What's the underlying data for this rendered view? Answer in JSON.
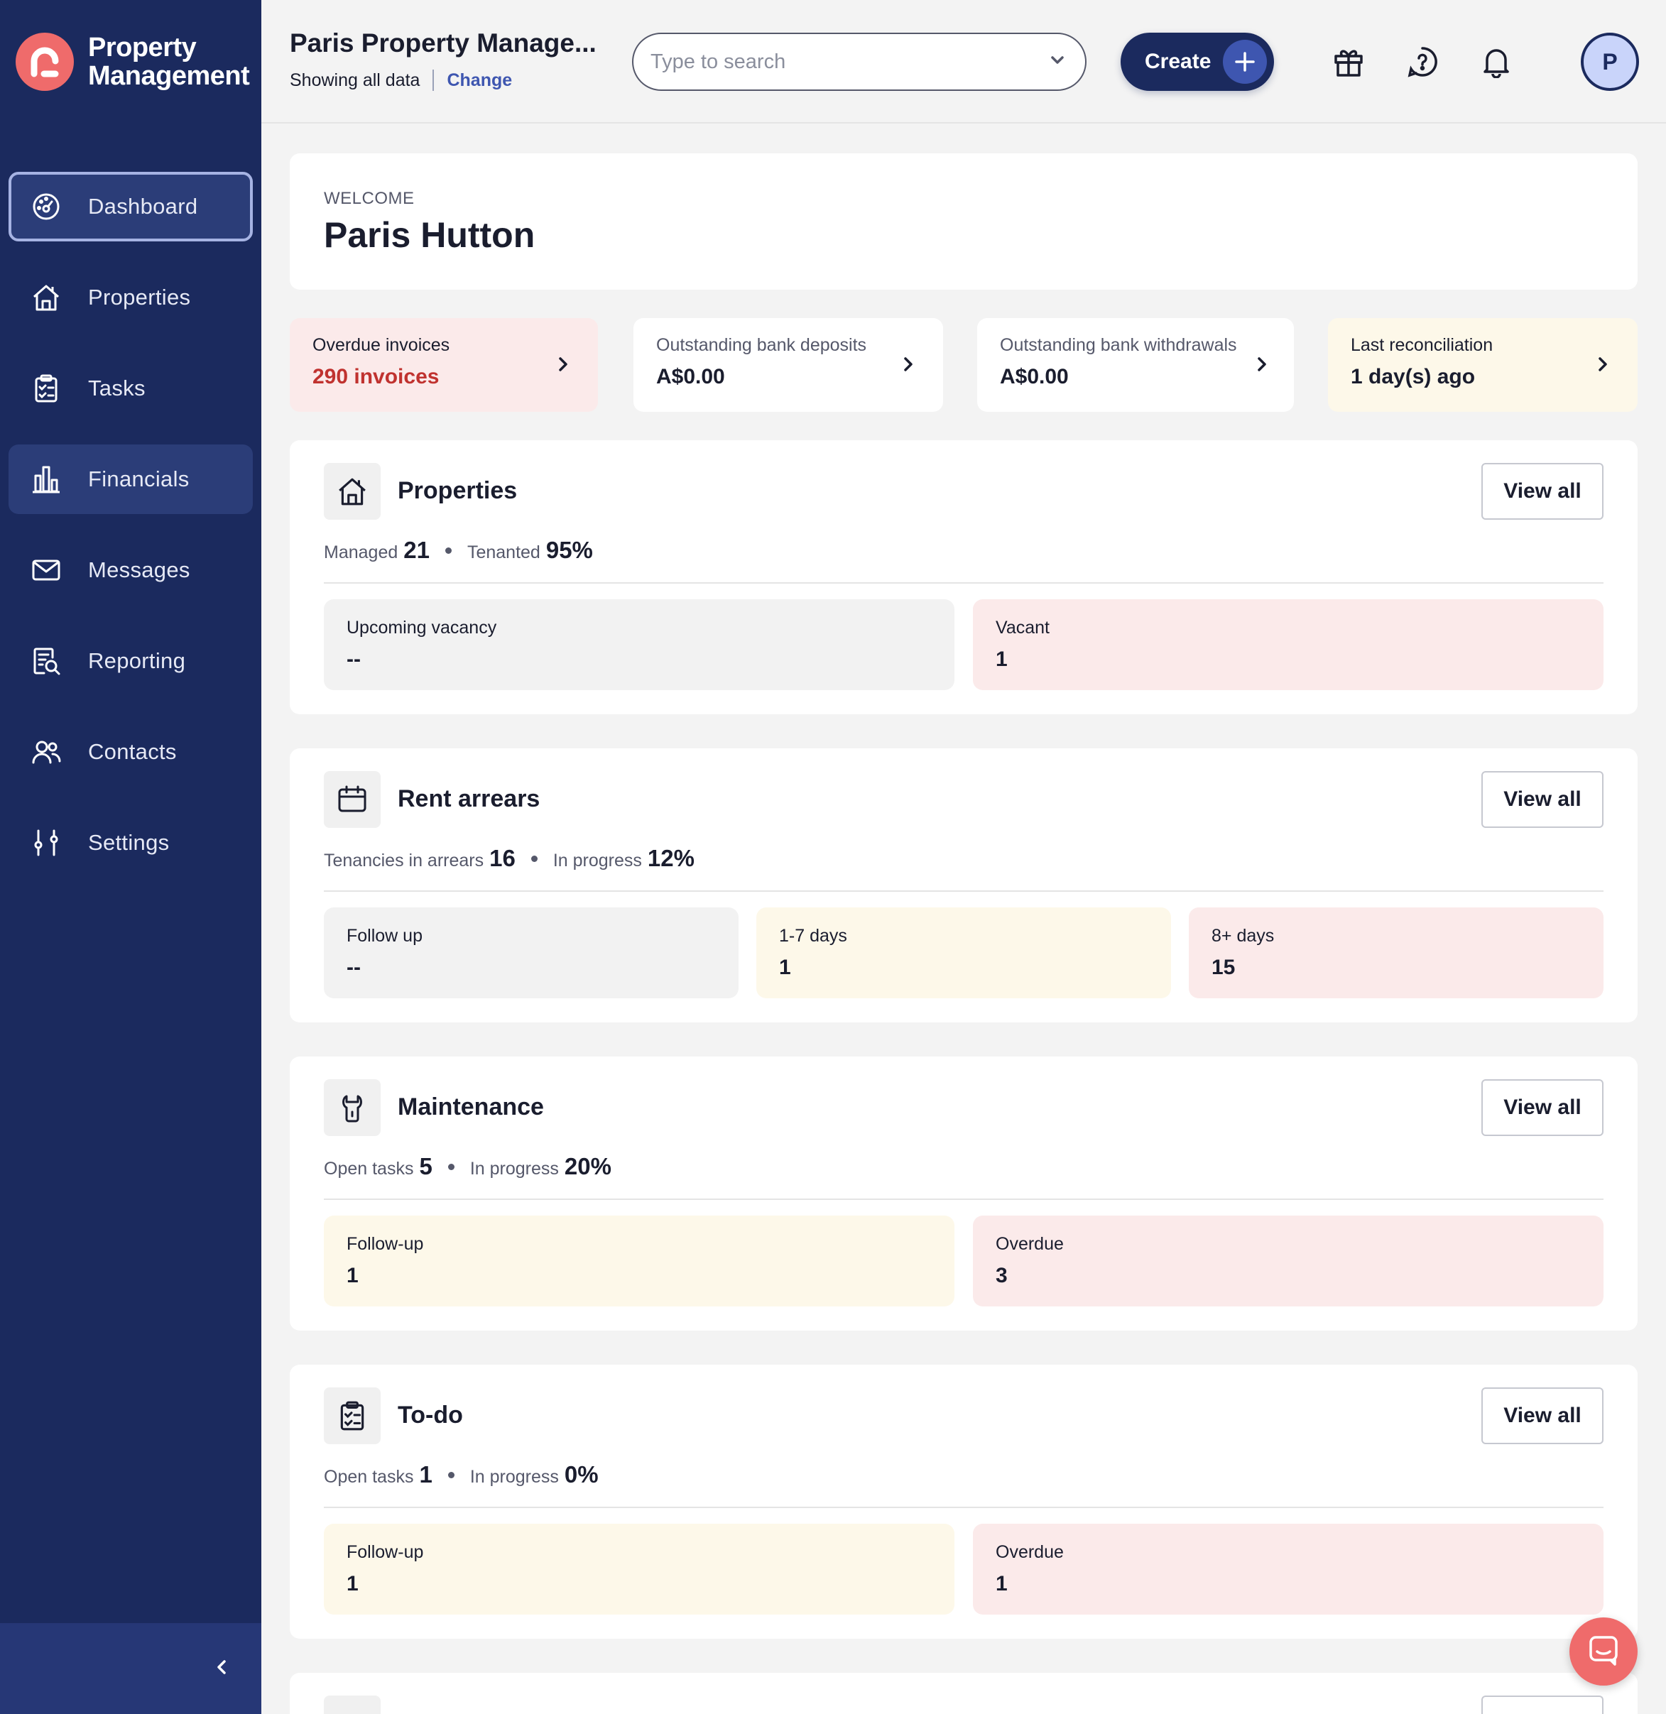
{
  "brand": {
    "line1": "Property",
    "line2": "Management",
    "logo_icon": "brand-logo-icon",
    "logo_color": "#ef6b6b"
  },
  "sidebar": {
    "items": [
      {
        "label": "Dashboard",
        "icon": "dashboard-icon"
      },
      {
        "label": "Properties",
        "icon": "house-icon"
      },
      {
        "label": "Tasks",
        "icon": "clipboard-icon"
      },
      {
        "label": "Financials",
        "icon": "bar-chart-icon"
      },
      {
        "label": "Messages",
        "icon": "envelope-icon"
      },
      {
        "label": "Reporting",
        "icon": "report-search-icon"
      },
      {
        "label": "Contacts",
        "icon": "users-icon"
      },
      {
        "label": "Settings",
        "icon": "sliders-icon"
      }
    ],
    "active": "Dashboard",
    "collapse_icon": "chevron-left-icon"
  },
  "header": {
    "org_title": "Paris Property Manage...",
    "org_sub": "Showing all data",
    "change_link": "Change",
    "search_placeholder": "Type to search",
    "create_label": "Create",
    "avatar_initial": "P"
  },
  "welcome": {
    "eyebrow": "WELCOME",
    "name": "Paris Hutton"
  },
  "stats": [
    {
      "label": "Overdue invoices",
      "value": "290 invoices"
    },
    {
      "label": "Outstanding bank deposits",
      "value": "A$0.00"
    },
    {
      "label": "Outstanding bank withdrawals",
      "value": "A$0.00"
    },
    {
      "label": "Last reconciliation",
      "value": "1 day(s) ago"
    }
  ],
  "sections": {
    "properties": {
      "title": "Properties",
      "view_all": "View all",
      "m1_label": "Managed",
      "m1_value": "21",
      "m2_label": "Tenanted",
      "m2_value": "95%",
      "tiles": [
        {
          "label": "Upcoming vacancy",
          "value": "--"
        },
        {
          "label": "Vacant",
          "value": "1"
        }
      ]
    },
    "rent_arrears": {
      "title": "Rent arrears",
      "view_all": "View all",
      "m1_label": "Tenancies in arrears",
      "m1_value": "16",
      "m2_label": "In progress",
      "m2_value": "12%",
      "tiles": [
        {
          "label": "Follow up",
          "value": "--"
        },
        {
          "label": "1-7 days",
          "value": "1"
        },
        {
          "label": "8+ days",
          "value": "15"
        }
      ]
    },
    "maintenance": {
      "title": "Maintenance",
      "view_all": "View all",
      "m1_label": "Open tasks",
      "m1_value": "5",
      "m2_label": "In progress",
      "m2_value": "20%",
      "tiles": [
        {
          "label": "Follow-up",
          "value": "1"
        },
        {
          "label": "Overdue",
          "value": "3"
        }
      ]
    },
    "todo": {
      "title": "To-do",
      "view_all": "View all",
      "m1_label": "Open tasks",
      "m1_value": "1",
      "m2_label": "In progress",
      "m2_value": "0%",
      "tiles": [
        {
          "label": "Follow-up",
          "value": "1"
        },
        {
          "label": "Overdue",
          "value": "1"
        }
      ]
    }
  },
  "colors": {
    "sidebar": "#1b2a5e",
    "accent": "#3e56b0",
    "danger": "#c0322f",
    "pink_tile": "#fbeaea",
    "cream_tile": "#fdf8e9"
  }
}
